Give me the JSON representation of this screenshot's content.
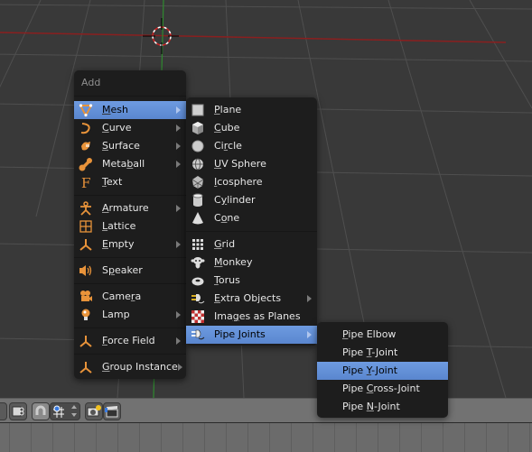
{
  "viewport": {
    "name": "3D View",
    "cursor": "3d-cursor"
  },
  "add_menu": {
    "title": "Add",
    "groups": [
      [
        {
          "label": "Mesh",
          "underline": "M",
          "icon": "mesh-icon",
          "submenu": true,
          "highlighted": true
        },
        {
          "label": "Curve",
          "underline": "C",
          "icon": "curve-icon",
          "submenu": true
        },
        {
          "label": "Surface",
          "underline": "S",
          "icon": "surface-icon",
          "submenu": true
        },
        {
          "label": "Metaball",
          "underline": "b",
          "icon": "metaball-icon",
          "submenu": true
        },
        {
          "label": "Text",
          "underline": "T",
          "icon": "text-icon",
          "submenu": false
        }
      ],
      [
        {
          "label": "Armature",
          "underline": "A",
          "icon": "armature-icon",
          "submenu": true
        },
        {
          "label": "Lattice",
          "underline": "L",
          "icon": "lattice-icon",
          "submenu": false
        },
        {
          "label": "Empty",
          "underline": "E",
          "icon": "empty-icon",
          "submenu": true
        }
      ],
      [
        {
          "label": "Speaker",
          "underline": "p",
          "icon": "speaker-icon",
          "submenu": false
        }
      ],
      [
        {
          "label": "Camera",
          "underline": "r",
          "icon": "camera-icon",
          "submenu": false
        },
        {
          "label": "Lamp",
          "underline": "",
          "icon": "lamp-icon",
          "submenu": true
        }
      ],
      [
        {
          "label": "Force Field",
          "underline": "F",
          "icon": "force-field-icon",
          "submenu": true
        }
      ],
      [
        {
          "label": "Group Instance",
          "underline": "G",
          "icon": "group-instance-icon",
          "submenu": true
        }
      ]
    ]
  },
  "mesh_menu": {
    "groups": [
      [
        {
          "label": "Plane",
          "underline": "P",
          "icon": "plane-icon"
        },
        {
          "label": "Cube",
          "underline": "C",
          "icon": "cube-icon"
        },
        {
          "label": "Circle",
          "underline": "r",
          "icon": "circle-icon"
        },
        {
          "label": "UV Sphere",
          "underline": "U",
          "icon": "uv-sphere-icon"
        },
        {
          "label": "Icosphere",
          "underline": "I",
          "icon": "icosphere-icon"
        },
        {
          "label": "Cylinder",
          "underline": "y",
          "icon": "cylinder-icon"
        },
        {
          "label": "Cone",
          "underline": "o",
          "icon": "cone-icon"
        }
      ],
      [
        {
          "label": "Grid",
          "underline": "G",
          "icon": "grid-icon"
        },
        {
          "label": "Monkey",
          "underline": "M",
          "icon": "monkey-icon"
        },
        {
          "label": "Torus",
          "underline": "T",
          "icon": "torus-icon"
        },
        {
          "label": "Extra Objects",
          "underline": "E",
          "icon": "extra-objects-icon",
          "submenu": true
        },
        {
          "label": "Images as Planes",
          "underline": "g",
          "icon": "images-as-planes-icon"
        },
        {
          "label": "Pipe Joints",
          "underline": "J",
          "icon": "pipe-joints-icon",
          "submenu": true,
          "highlighted": true
        }
      ]
    ]
  },
  "pipe_menu": {
    "items": [
      {
        "label": "Pipe Elbow",
        "underline": "P"
      },
      {
        "label": "Pipe T-Joint",
        "underline": "T"
      },
      {
        "label": "Pipe Y-Joint",
        "underline": "Y",
        "highlighted": true
      },
      {
        "label": "Pipe Cross-Joint",
        "underline": "C"
      },
      {
        "label": "Pipe N-Joint",
        "underline": "N"
      }
    ]
  },
  "header": {
    "buttons": [
      "layer-toggle",
      "proportional-edit",
      "snap-toggle",
      "snap-element",
      "render-opengl",
      "render-animation"
    ]
  },
  "colors": {
    "highlight": "#6e9be0",
    "menu_bg": "#1d1d1d",
    "icon_orange": "#e8933a",
    "viewport_bg": "#393939",
    "x_axis": "#8a1f1f",
    "y_axis": "#2f8a2f"
  }
}
